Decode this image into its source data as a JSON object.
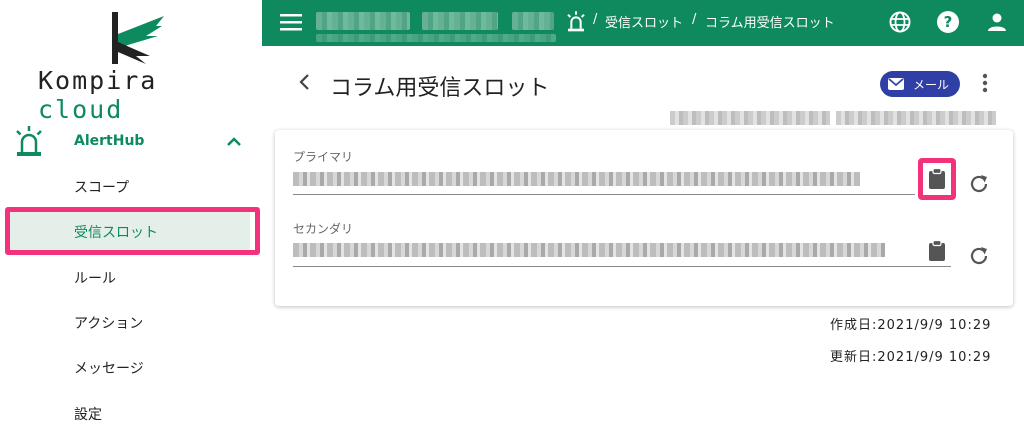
{
  "sidebar": {
    "logo": {
      "word1": "Kompira",
      "word2": "cloud"
    },
    "group": {
      "label": "AlertHub",
      "icon": "siren-icon",
      "chevron": "chevron-up-icon"
    },
    "items": [
      {
        "label": "スコープ"
      },
      {
        "label": "受信スロット",
        "active": true
      },
      {
        "label": "ルール"
      },
      {
        "label": "アクション"
      },
      {
        "label": "メッセージ"
      },
      {
        "label": "設定"
      }
    ]
  },
  "topbar": {
    "color": "#0f8a5f",
    "breadcrumb": [
      {
        "label": "受信スロット"
      },
      {
        "label": "コラム用受信スロット"
      }
    ],
    "separator": "/",
    "icons": [
      "menu-icon",
      "siren-icon",
      "globe-icon",
      "help-icon",
      "account-icon"
    ]
  },
  "page": {
    "title": "コラム用受信スロット",
    "mail_chip": "メール",
    "fields": [
      {
        "label": "プライマリ"
      },
      {
        "label": "セカンダリ"
      }
    ],
    "created": "作成日:2021/9/9 10:29",
    "updated": "更新日:2021/9/9 10:29"
  },
  "colors": {
    "brand": "#0f8a5f",
    "highlight": "#f2337b",
    "chip": "#2f3fa5"
  }
}
